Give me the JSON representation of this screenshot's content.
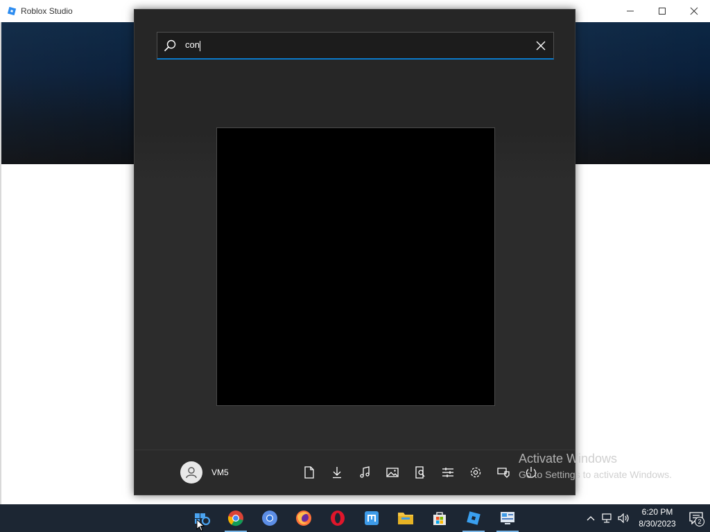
{
  "background_window": {
    "title": "Roblox Studio",
    "controls": [
      "minimize",
      "maximize",
      "close"
    ]
  },
  "start_menu": {
    "search": {
      "value": "con",
      "clear_icon": "close-icon",
      "search_icon": "search-icon"
    },
    "user": {
      "name": "VM5",
      "avatar_icon": "user-icon"
    },
    "quick_links": [
      {
        "name": "documents",
        "icon": "document-icon"
      },
      {
        "name": "downloads",
        "icon": "download-icon"
      },
      {
        "name": "music",
        "icon": "music-icon"
      },
      {
        "name": "pictures",
        "icon": "picture-icon"
      },
      {
        "name": "file-explorer",
        "icon": "explorer-icon"
      },
      {
        "name": "personalization",
        "icon": "sliders-icon"
      },
      {
        "name": "settings",
        "icon": "gear-icon"
      },
      {
        "name": "network",
        "icon": "network-icon"
      },
      {
        "name": "power",
        "icon": "power-icon"
      }
    ]
  },
  "watermark": {
    "title": "Activate Windows",
    "subtitle": "Go to Settings to activate Windows."
  },
  "taskbar": {
    "apps": [
      {
        "name": "start",
        "icon": "windows-start-icon",
        "active": false
      },
      {
        "name": "chrome",
        "icon": "chrome-icon",
        "active": true
      },
      {
        "name": "chromium",
        "icon": "chromium-icon",
        "active": false
      },
      {
        "name": "firefox",
        "icon": "firefox-icon",
        "active": false
      },
      {
        "name": "opera",
        "icon": "opera-icon",
        "active": false
      },
      {
        "name": "maxthon",
        "icon": "maxthon-icon",
        "active": false
      },
      {
        "name": "file-explorer",
        "icon": "folder-icon",
        "active": false
      },
      {
        "name": "store",
        "icon": "store-icon",
        "active": false
      },
      {
        "name": "roblox-studio",
        "icon": "roblox-icon",
        "active": true
      },
      {
        "name": "control-panel",
        "icon": "control-panel-icon",
        "active": true
      }
    ],
    "tray": {
      "time": "6:20 PM",
      "date": "8/30/2023",
      "notification_count": "2"
    }
  },
  "colors": {
    "accent": "#0a7acc",
    "start_bg": "#2c2c2c",
    "taskbar_bg": "#1c2633"
  }
}
